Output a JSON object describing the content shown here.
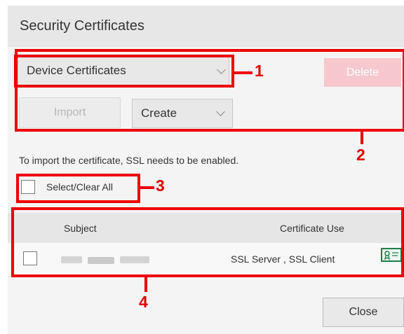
{
  "dialog": {
    "title": "Security Certificates"
  },
  "certificate_type_select": {
    "value": "Device Certificates"
  },
  "buttons": {
    "delete": "Delete",
    "import": "Import",
    "close": "Close"
  },
  "create_select": {
    "value": "Create"
  },
  "hint_text": "To import the certificate, SSL needs to be enabled.",
  "select_all": {
    "label": "Select/Clear All",
    "checked": false
  },
  "table": {
    "columns": [
      "Subject",
      "Certificate Use"
    ],
    "rows": [
      {
        "subject": "",
        "certificate_use": "SSL Server , SSL Client",
        "icon": "certificate-icon",
        "checked": false
      }
    ]
  },
  "annotations": [
    "1",
    "2",
    "3",
    "4"
  ],
  "colors": {
    "annotation_red": "#ee0000",
    "delete_disabled": "#f6c8cd",
    "certificate_icon_green": "#1e7d47"
  }
}
